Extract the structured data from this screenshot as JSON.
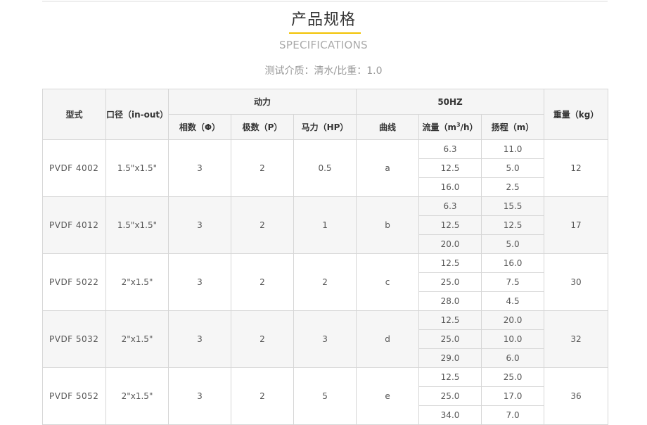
{
  "title": "产品规格",
  "subtitle": "SPECIFICATIONS",
  "medium": "测试介质：清水/比重：1.0",
  "headers": {
    "model": "型式",
    "port": "口径（in-out）",
    "power": "动力",
    "phase": "相数（Φ）",
    "poles": "极数（P）",
    "hp": "马力（HP）",
    "freq": "50HZ",
    "curve": "曲线",
    "flow_pre": "流量（m",
    "flow_sup": "3",
    "flow_post": "/h）",
    "head": "扬程（m）",
    "weight": "重量（kg）"
  },
  "rows": [
    {
      "model": "PVDF 4002",
      "port": "1.5\"x1.5\"",
      "phase": "3",
      "poles": "2",
      "hp": "0.5",
      "curve": "a",
      "flow": [
        "6.3",
        "12.5",
        "16.0"
      ],
      "head": [
        "11.0",
        "5.0",
        "2.5"
      ],
      "weight": "12"
    },
    {
      "model": "PVDF 4012",
      "port": "1.5\"x1.5\"",
      "phase": "3",
      "poles": "2",
      "hp": "1",
      "curve": "b",
      "flow": [
        "6.3",
        "12.5",
        "20.0"
      ],
      "head": [
        "15.5",
        "12.5",
        "5.0"
      ],
      "weight": "17"
    },
    {
      "model": "PVDF 5022",
      "port": "2\"x1.5\"",
      "phase": "3",
      "poles": "2",
      "hp": "2",
      "curve": "c",
      "flow": [
        "12.5",
        "25.0",
        "28.0"
      ],
      "head": [
        "16.0",
        "7.5",
        "4.5"
      ],
      "weight": "30"
    },
    {
      "model": "PVDF 5032",
      "port": "2\"x1.5\"",
      "phase": "3",
      "poles": "2",
      "hp": "3",
      "curve": "d",
      "flow": [
        "12.5",
        "25.0",
        "29.0"
      ],
      "head": [
        "20.0",
        "10.0",
        "6.0"
      ],
      "weight": "32"
    },
    {
      "model": "PVDF 5052",
      "port": "2\"x1.5\"",
      "phase": "3",
      "poles": "2",
      "hp": "5",
      "curve": "e",
      "flow": [
        "12.5",
        "25.0",
        "34.0"
      ],
      "head": [
        "25.0",
        "17.0",
        "7.0"
      ],
      "weight": "36"
    }
  ]
}
